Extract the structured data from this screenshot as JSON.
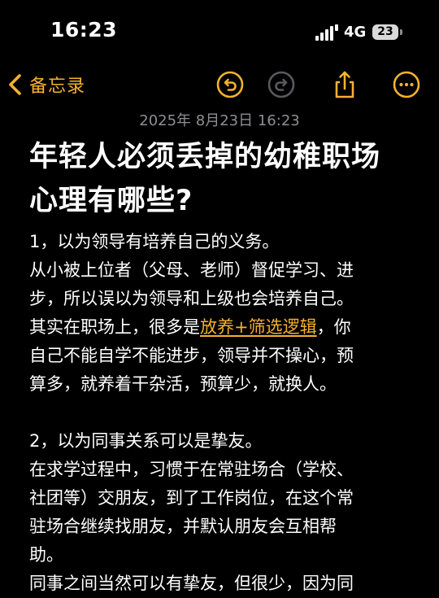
{
  "status_bar": {
    "time": "16:23",
    "network": "4G",
    "battery": "23"
  },
  "nav": {
    "back_label": "备忘录",
    "icons": {
      "back": "chevron-left-icon",
      "undo": "undo-icon",
      "redo": "redo-icon",
      "share": "share-icon",
      "more": "more-icon"
    },
    "accent_color": "#f5b22e",
    "disabled_color": "#5a5a5e"
  },
  "note": {
    "date": "2025年 8月23日 16:23",
    "title": "年轻人必须丢掉的幼稚职场心理有哪些?",
    "title_lines": [
      "年轻人必须丢掉的幼稚职场",
      "心理有哪些?"
    ],
    "point1": {
      "heading": "1，以为领导有培养自己的义务。",
      "line1": "从小被上位者（父母、老师）督促学习、进",
      "line2": "步，所以误以为领导和上级也会培养自己。",
      "line3_before": "其实在职场上，很多是",
      "line3_link": "放养+筛选逻辑",
      "line3_after": "，你",
      "line4": "自己不能自学不能进步，领导并不操心，预",
      "line5": "算多，就养着干杂活，预算少，就换人。"
    },
    "point2": {
      "heading": "2，以为同事关系可以是挚友。",
      "line1": "在求学过程中，习惯于在常驻场合（学校、",
      "line2": "社团等）交朋友，到了工作岗位，在这个常",
      "line3": "驻场合继续找朋友，并默认朋友会互相帮",
      "line4": "助。",
      "line5": "同事之间当然可以有挚友，但很少，因为同"
    }
  }
}
